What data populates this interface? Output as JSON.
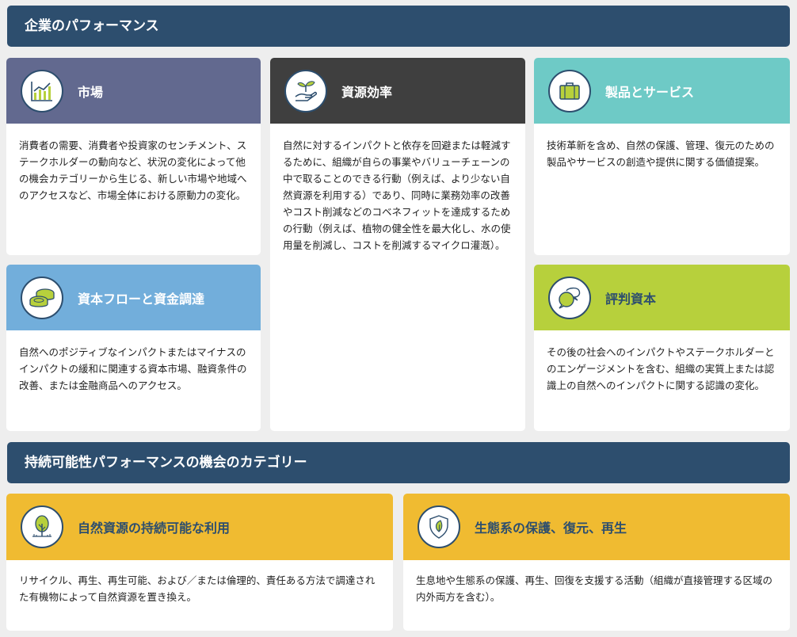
{
  "banners": {
    "corporate": "企業のパフォーマンス",
    "sustainability": "持続可能性パフォーマンスの機会のカテゴリー"
  },
  "cards": {
    "market": {
      "title": "市場",
      "body": "消費者の需要、消費者や投資家のセンチメント、ステークホルダーの動向など、状況の変化によって他の機会カテゴリーから生じる、新しい市場や地域へのアクセスなど、市場全体における原動力の変化。",
      "icon": "bar-chart-icon"
    },
    "resource": {
      "title": "資源効率",
      "body": "自然に対するインパクトと依存を回避または軽減するために、組織が自らの事業やバリューチェーンの中で取ることのできる行動（例えば、より少ない自然資源を利用する）であり、同時に業務効率の改善やコスト削減などのコベネフィットを達成するための行動（例えば、植物の健全性を最大化し、水の使用量を削減し、コストを削減するマイクロ灌漑）。",
      "icon": "hand-sprout-icon"
    },
    "product": {
      "title": "製品とサービス",
      "body": "技術革新を含め、自然の保護、管理、復元のための製品やサービスの創造や提供に関する価値提案。",
      "icon": "briefcase-icon"
    },
    "capital": {
      "title": "資本フローと資金調達",
      "body": "自然へのポジティブなインパクトまたはマイナスのインパクトの緩和に関連する資本市場、融資条件の改善、または金融商品へのアクセス。",
      "icon": "coins-icon"
    },
    "reputation": {
      "title": "評判資本",
      "body": "その後の社会へのインパクトやステークホルダーとのエンゲージメントを含む、組織の実質上または認識上の自然へのインパクトに関する認識の変化。",
      "icon": "speech-bubbles-icon"
    },
    "natural": {
      "title": "自然資源の持続可能な利用",
      "body": "リサイクル、再生、再生可能、および／または倫理的、責任ある方法で調達された有機物によって自然資源を置き換え。",
      "icon": "tree-icon"
    },
    "eco": {
      "title": "生態系の保護、復元、再生",
      "body": "生息地や生態系の保護、再生、回復を支援する活動（組織が直接管理する区域の内外両方を含む）。",
      "icon": "shield-leaf-icon"
    }
  },
  "colors": {
    "banner": "#2d4e6e",
    "market": "#62698f",
    "resource": "#3f3f3f",
    "product": "#6ecac6",
    "capital": "#72aedb",
    "reputation": "#b7d03c",
    "sustainability": "#f0bb31"
  }
}
